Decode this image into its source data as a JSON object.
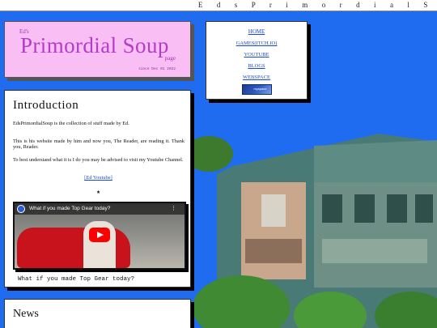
{
  "topbar": {
    "text": "E d s P r i m o r d i a l S"
  },
  "title_card": {
    "eyebrow": "Ed's",
    "title": "Primordial Soup",
    "subtitle": "page",
    "since": "since Dec 01 2022"
  },
  "nav": {
    "items": [
      {
        "label": "HOME"
      },
      {
        "label": "GAMES(ITCH.IO)"
      },
      {
        "label": "YOUTUBE"
      },
      {
        "label": "BLOGS"
      },
      {
        "label": "WEBSPACE"
      }
    ],
    "badge_text": "myspace"
  },
  "intro": {
    "heading": "Introduction",
    "p1": "EdsPrimordialSoup is the collection of stuff made by Ed.",
    "p2": "This is his website made by him and now you, The Reader, are reading it. Thank you, Reader.",
    "p3": "To best understand what it is I do you may be advised to visit my Youtube Channel.",
    "link": "[Ed Youtube]",
    "star": "★",
    "video_title": "What if you made Top Gear today?",
    "video_menu": "⋮",
    "caption": "What if you made Top Gear today?"
  },
  "news": {
    "heading": "News"
  },
  "colors": {
    "background": "#1f6cf0",
    "title_card": "#f9bff4",
    "title_text": "#b33cc8",
    "link": "#1a48d8",
    "play_button": "#ff0000"
  }
}
